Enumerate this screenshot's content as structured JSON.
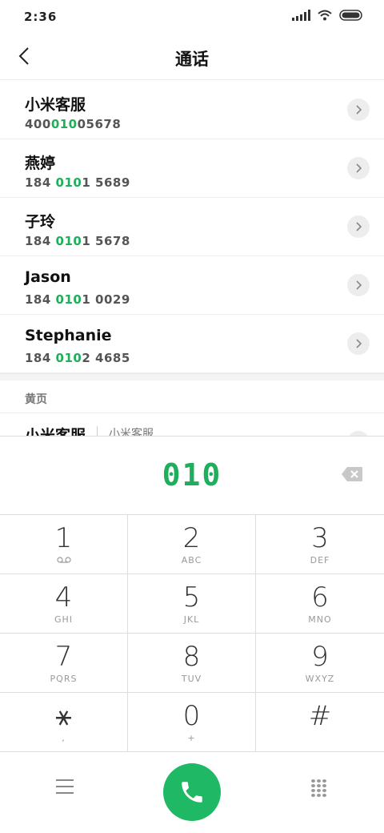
{
  "status_bar": {
    "time": "2:36"
  },
  "header": {
    "title": "通话"
  },
  "query": "010",
  "contacts": [
    {
      "name": "小米客服",
      "number_pre": "400",
      "number_match": "010",
      "number_post": "05678"
    },
    {
      "name": "燕婷",
      "number_pre": "184 ",
      "number_match": "010",
      "number_post": "1 5689"
    },
    {
      "name": "子玲",
      "number_pre": "184 ",
      "number_match": "010",
      "number_post": "1 5678"
    },
    {
      "name": "Jason",
      "number_pre": "184 ",
      "number_match": "010",
      "number_post": "1 0029"
    },
    {
      "name": "Stephanie",
      "number_pre": "184 ",
      "number_match": "010",
      "number_post": "2 4685"
    }
  ],
  "yellow_pages": {
    "label": "黄页",
    "items": [
      {
        "name": "小米客服",
        "category": "小米客服"
      }
    ]
  },
  "keypad": [
    {
      "digit": "1",
      "letters": ""
    },
    {
      "digit": "2",
      "letters": "ABC"
    },
    {
      "digit": "3",
      "letters": "DEF"
    },
    {
      "digit": "4",
      "letters": "GHI"
    },
    {
      "digit": "5",
      "letters": "JKL"
    },
    {
      "digit": "6",
      "letters": "MNO"
    },
    {
      "digit": "7",
      "letters": "PQRS"
    },
    {
      "digit": "8",
      "letters": "TUV"
    },
    {
      "digit": "9",
      "letters": "WXYZ"
    },
    {
      "digit": "⚹",
      "letters": ","
    },
    {
      "digit": "0",
      "letters": "+"
    },
    {
      "digit": "#",
      "letters": ""
    }
  ],
  "colors": {
    "accent": "#1fae5b",
    "call_button": "#1fb864"
  },
  "icons": {
    "back": "chevron-left-icon",
    "detail": "chevron-right-icon",
    "backspace": "backspace-icon",
    "voicemail": "voicemail-icon",
    "menu": "menu-icon",
    "call": "phone-icon",
    "keypad": "keypad-icon"
  }
}
